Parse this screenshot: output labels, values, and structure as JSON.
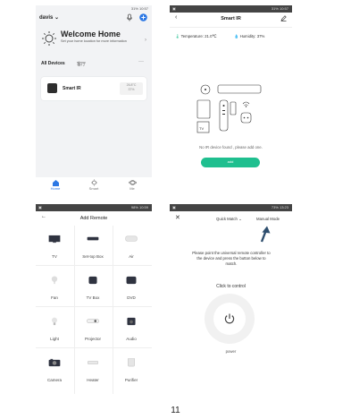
{
  "page_number": "11",
  "home": {
    "status_time": "10:57",
    "status_battery": "31%",
    "user_name": "davis",
    "welcome_title": "Welcome Home",
    "welcome_subtitle": "Set your home location for more information",
    "tab_all_devices": "All Devices",
    "tab_second": "客厅",
    "more": "···",
    "device_name": "Smart IR",
    "device_temp": "26.8°C",
    "device_hum": "37%",
    "nav": [
      {
        "label": "Home"
      },
      {
        "label": "Smart"
      },
      {
        "label": "Me"
      }
    ],
    "accent": "#2c78e4"
  },
  "smart_ir": {
    "status_time": "10:57",
    "status_battery": "31%",
    "title": "Smart IR",
    "temperature_label": "Temperature:",
    "temperature_value": "21.0℃",
    "humidity_label": "Humidity:",
    "humidity_value": "37%",
    "tv_label": "TV",
    "empty_message": "No IR device found , please add one.",
    "add_label": "add",
    "accent": "#1fbf8f"
  },
  "add_remote": {
    "status_time": "10:59",
    "status_battery": "98%",
    "title": "Add Remote",
    "items": [
      {
        "label": "TV",
        "icon": "tv-icon"
      },
      {
        "label": "Set-top Box",
        "icon": "set-top-box-icon"
      },
      {
        "label": "Air",
        "icon": "air-conditioner-icon"
      },
      {
        "label": "Fan",
        "icon": "fan-icon"
      },
      {
        "label": "TV Box",
        "icon": "tv-box-icon"
      },
      {
        "label": "DVD",
        "icon": "dvd-icon"
      },
      {
        "label": "Light",
        "icon": "light-icon"
      },
      {
        "label": "Projector",
        "icon": "projector-icon"
      },
      {
        "label": "Audio",
        "icon": "audio-icon"
      },
      {
        "label": "Camera",
        "icon": "camera-icon"
      },
      {
        "label": "Heater",
        "icon": "heater-icon"
      },
      {
        "label": "Purifier",
        "icon": "purifier-icon"
      }
    ]
  },
  "match": {
    "status_time": "13:23",
    "status_battery": "73%",
    "quick_match": "Quick Match",
    "manual_mode": "Manual Mode",
    "instruction": "Please point the universal remote controller to the device and press the button below to match.",
    "click_to_control": "Click to control",
    "power_label": "power"
  }
}
